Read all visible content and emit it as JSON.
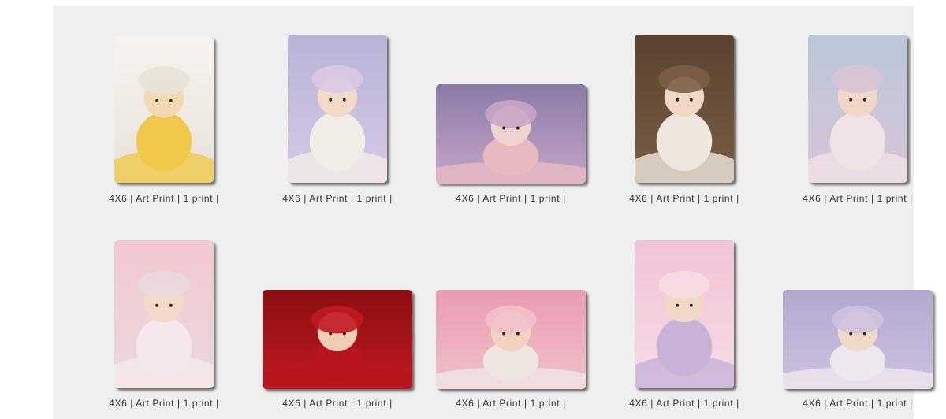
{
  "gallery": {
    "items": [
      {
        "caption": "4X6 | Art Print | 1 print |",
        "subject": "baby-in-tub-photo",
        "colors": [
          "#f6f3ee",
          "#e8e2d8",
          "#f4d8b2",
          "#f0c94a"
        ]
      },
      {
        "caption": "4X6 | Art Print | 1 print |",
        "subject": "baby-flower-bonnet-photo",
        "colors": [
          "#b7b3d6",
          "#d8c9e6",
          "#f3d9c8",
          "#f2ece6"
        ]
      },
      {
        "caption": "4X6 | Art Print | 1 print |",
        "subject": "crawling-baby-photo",
        "colors": [
          "#8a7aa8",
          "#c6a6c6",
          "#efd3d0",
          "#e9b9c0"
        ]
      },
      {
        "caption": "4X6 | Art Print | 1 print |",
        "subject": "baby-with-teddy-bear-photo",
        "colors": [
          "#5a4330",
          "#7b5e45",
          "#efd9c6",
          "#eee7dd"
        ]
      },
      {
        "caption": "4X6 | Art Print | 1 print |",
        "subject": "baby-on-bench-photo",
        "colors": [
          "#b9c7d8",
          "#d8c4d6",
          "#f2d6c8",
          "#f1e2e6"
        ]
      },
      {
        "caption": "4X6 | Art Print | 1 print |",
        "subject": "baby-pink-floral-photo",
        "colors": [
          "#f2c8cf",
          "#ead9de",
          "#f4d9c9",
          "#f6e8ea"
        ]
      },
      {
        "caption": "4X6 | Art Print | 1 print |",
        "subject": "baby-red-dress-photo",
        "colors": [
          "#8b0e10",
          "#c01a20",
          "#f1cdb5",
          "#b8141c"
        ]
      },
      {
        "caption": "4X6 | Art Print | 1 print |",
        "subject": "baby-rainbow-bonnet-photo",
        "colors": [
          "#e99bb0",
          "#f2c1c9",
          "#f3d2c0",
          "#efe6e2"
        ]
      },
      {
        "caption": "4X6 | Art Print | 1 print |",
        "subject": "baby-in-purple-pot-photo",
        "colors": [
          "#f0c3d6",
          "#f6dbe6",
          "#f1d7c4",
          "#c9b2d8"
        ]
      },
      {
        "caption": "4X6 | Art Print | 1 print |",
        "subject": "baby-closeup-bonnet-photo",
        "colors": [
          "#b2a8cf",
          "#cfc1e0",
          "#f2d8c7",
          "#efe7ee"
        ]
      }
    ]
  }
}
